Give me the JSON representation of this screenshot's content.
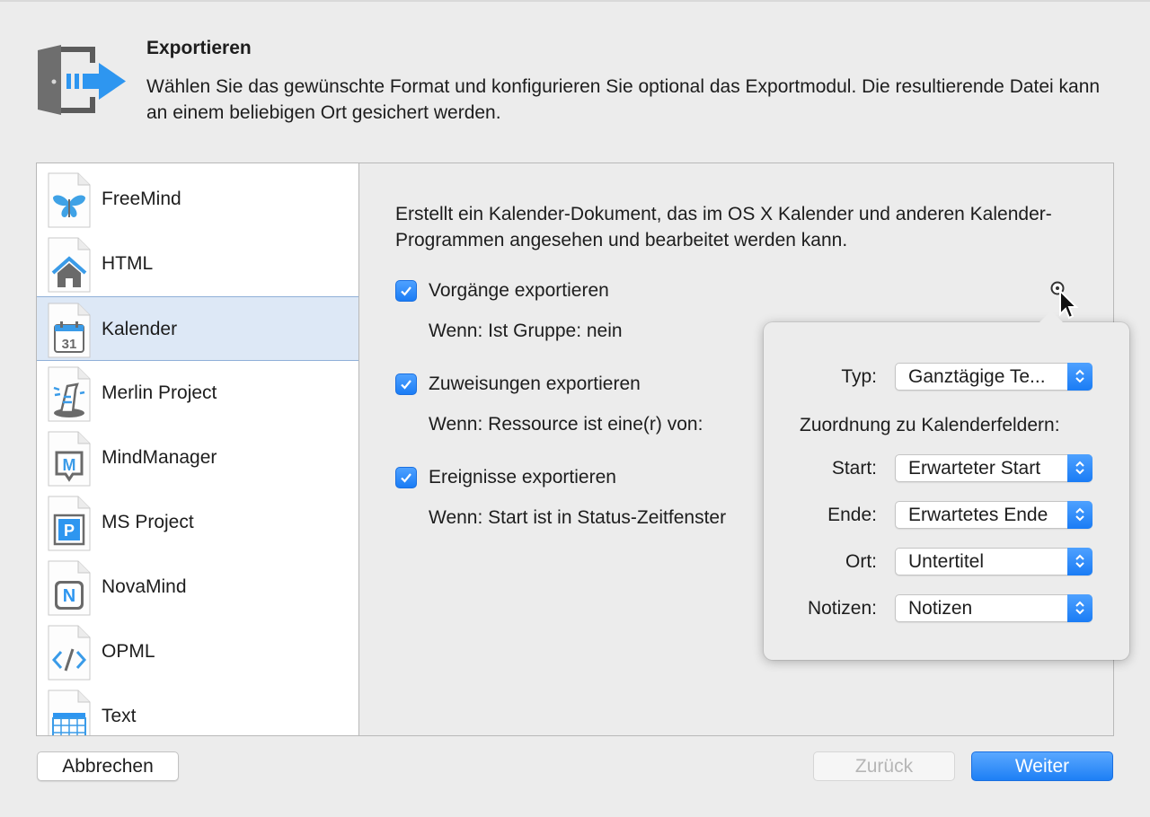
{
  "header": {
    "title": "Exportieren",
    "description": "Wählen Sie das gewünschte Format und konfigurieren Sie optional das Exportmodul. Die resultierende Datei kann an einem beliebigen Ort gesichert werden."
  },
  "formats": [
    {
      "label": "FreeMind",
      "icon": "butterfly-icon",
      "selected": false
    },
    {
      "label": "HTML",
      "icon": "house-icon",
      "selected": false
    },
    {
      "label": "Kalender",
      "icon": "calendar-icon",
      "icon_text": "31",
      "selected": true
    },
    {
      "label": "Merlin Project",
      "icon": "wizard-hat-icon",
      "selected": false
    },
    {
      "label": "MindManager",
      "icon": "mindmanager-icon",
      "icon_text": "M",
      "selected": false
    },
    {
      "label": "MS Project",
      "icon": "ms-project-icon",
      "icon_text": "P",
      "selected": false
    },
    {
      "label": "NovaMind",
      "icon": "novamind-icon",
      "icon_text": "N",
      "selected": false
    },
    {
      "label": "OPML",
      "icon": "code-icon",
      "selected": false
    },
    {
      "label": "Text",
      "icon": "table-icon",
      "selected": false
    }
  ],
  "pane": {
    "description": "Erstellt ein Kalender-Dokument, das im OS X Kalender und anderen Kalender-Programmen angesehen und bearbeitet werden kann.",
    "options": [
      {
        "label": "Vorgänge exportieren",
        "checked": true,
        "condition": "Wenn: Ist Gruppe: nein"
      },
      {
        "label": "Zuweisungen exportieren",
        "checked": true,
        "condition": "Wenn: Ressource ist eine(r) von:"
      },
      {
        "label": "Ereignisse exportieren",
        "checked": true,
        "condition": "Wenn: Start ist in Status-Zeitfenster"
      }
    ]
  },
  "popover": {
    "type_label": "Typ:",
    "type_value": "Ganztägige Te...",
    "mapping_heading": "Zuordnung zu Kalenderfeldern:",
    "fields": [
      {
        "label": "Start:",
        "value": "Erwarteter Start"
      },
      {
        "label": "Ende:",
        "value": "Erwartetes Ende"
      },
      {
        "label": "Ort:",
        "value": "Untertitel"
      },
      {
        "label": "Notizen:",
        "value": "Notizen"
      }
    ]
  },
  "buttons": {
    "cancel": "Abbrechen",
    "back": "Zurück",
    "next": "Weiter"
  },
  "colors": {
    "accent": "#1a7cf5",
    "selection": "#dde8f6",
    "window_bg": "#ececec"
  }
}
